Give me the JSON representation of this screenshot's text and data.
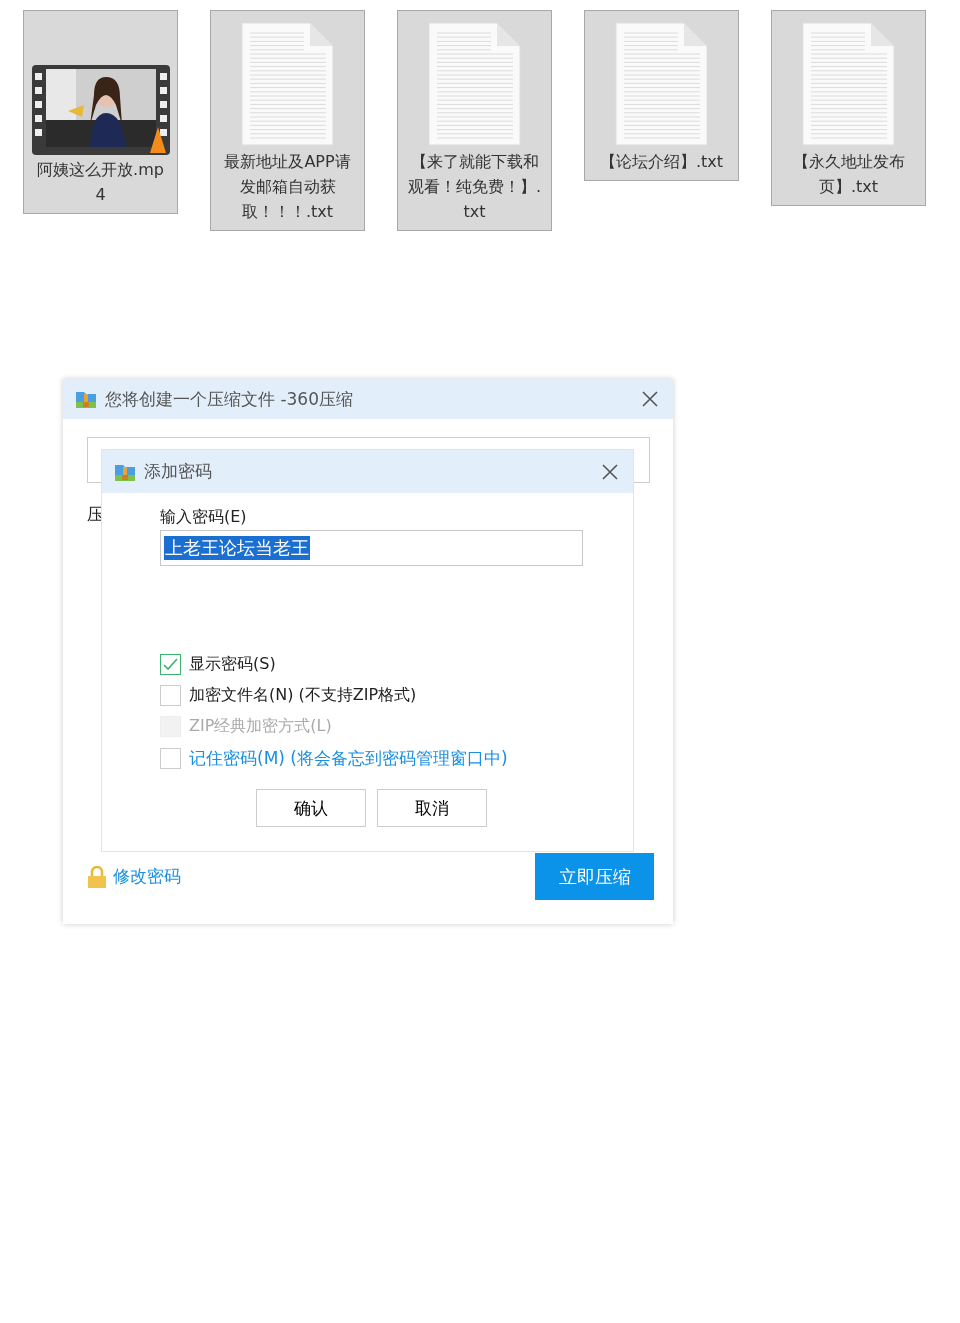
{
  "files": [
    {
      "kind": "video",
      "name": "阿姨这么开放.mp4"
    },
    {
      "kind": "text",
      "name": "最新地址及APP请发邮箱自动获取！！！.txt"
    },
    {
      "kind": "text",
      "name": "【来了就能下载和观看！纯免费！】.txt"
    },
    {
      "kind": "text",
      "name": "【论坛介绍】.txt"
    },
    {
      "kind": "text",
      "name": "【永久地址发布页】.txt"
    }
  ],
  "dialog": {
    "title": "您将创建一个压缩文件 -360压缩",
    "fragment_label": "压",
    "password_dialog": {
      "title": "添加密码",
      "field_label": "输入密码(E)",
      "value": "上老王论坛当老王",
      "value_selected": true,
      "options": [
        {
          "kind": "plain",
          "label": "显示密码(S)",
          "checked": true,
          "disabled": false
        },
        {
          "kind": "plain",
          "label": "加密文件名(N) (不支持ZIP格式)",
          "checked": false,
          "disabled": false
        },
        {
          "kind": "plain",
          "label": "ZIP经典加密方式(L)",
          "checked": false,
          "disabled": true
        },
        {
          "kind": "link",
          "label": "记住密码(M) (将会备忘到密码管理窗口中)",
          "checked": false,
          "disabled": false
        }
      ],
      "buttons": [
        "确认",
        "取消"
      ]
    },
    "change_password_link": "修改密码",
    "compress_button": "立即压缩"
  }
}
